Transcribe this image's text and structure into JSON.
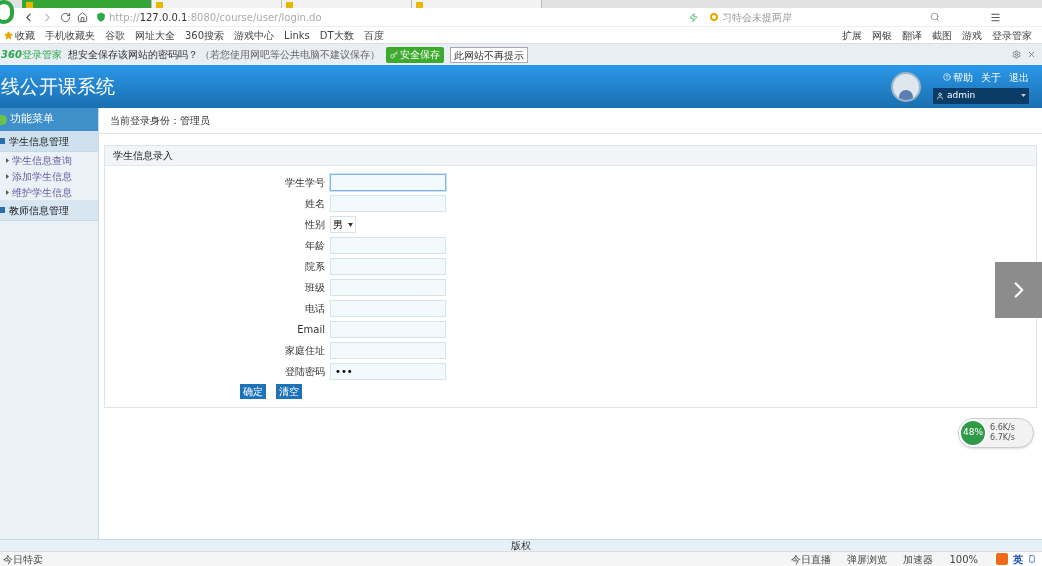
{
  "browser": {
    "tabs": [
      {
        "selected": true
      },
      {
        "selected": false
      },
      {
        "selected": false
      },
      {
        "selected": false
      }
    ],
    "address": {
      "host": "127.0.0.1",
      "prefix": "http://",
      "rest": ":8080/course/user/login.do"
    },
    "search": {
      "placeholder": "习特会未提两岸"
    },
    "bookmarks": [
      "收藏",
      "手机收藏夹",
      "谷歌",
      "网址大全",
      "360搜索",
      "游戏中心",
      "Links",
      "DT大数",
      "百度"
    ],
    "extensions": [
      "扩展",
      "网银",
      "翻译",
      "截图",
      "游戏",
      "登录管家"
    ],
    "password_bar": {
      "brand": "360",
      "brand_label": "登录管家",
      "message": "想安全保存该网站的密码吗？",
      "note": "（若您使用网吧等公共电脑不建议保存）",
      "save_button": "安全保存",
      "never_button": "此网站不再提示"
    }
  },
  "app": {
    "title": "线公开课系统",
    "links": [
      "帮助",
      "关于",
      "退出"
    ],
    "user": "admin",
    "menu_title": "功能菜单",
    "menu": [
      {
        "label": "学生信息管理",
        "expanded": true,
        "children": [
          {
            "label": "学生信息查询"
          },
          {
            "label": "添加学生信息"
          },
          {
            "label": "维护学生信息"
          }
        ]
      },
      {
        "label": "教师信息管理",
        "expanded": false
      }
    ],
    "breadcrumb": "当前登录身份：管理员",
    "panel_title": "学生信息录入",
    "fields": [
      {
        "label": "学生学号",
        "kind": "text",
        "focused": true
      },
      {
        "label": "姓名",
        "kind": "text",
        "focused": false
      },
      {
        "label": "性别",
        "kind": "select",
        "value": "男",
        "focused": false
      },
      {
        "label": "年龄",
        "kind": "text",
        "focused": false
      },
      {
        "label": "院系",
        "kind": "text",
        "focused": false
      },
      {
        "label": "班级",
        "kind": "text",
        "focused": false
      },
      {
        "label": "电话",
        "kind": "text",
        "focused": false
      },
      {
        "label": "Email",
        "kind": "text",
        "focused": false
      },
      {
        "label": "家庭住址",
        "kind": "text",
        "focused": false
      },
      {
        "label": "登陆密码",
        "kind": "password",
        "value": "•••",
        "focused": false
      }
    ],
    "buttons": [
      "确定",
      "清空"
    ],
    "footer": "版权"
  },
  "speed_widget": {
    "percent": "48%",
    "up": "6.6K/s",
    "down": "6.7K/s"
  },
  "status_bar": {
    "left": "今日特卖",
    "items": [
      "今日直播",
      "弹屏浏览",
      "加速器",
      "100%"
    ],
    "ime": "英"
  }
}
